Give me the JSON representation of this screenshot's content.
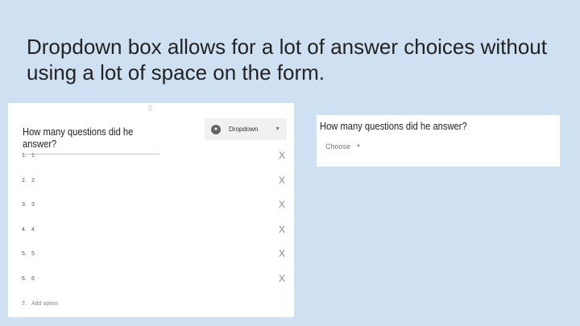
{
  "headline": "Dropdown box allows for a lot of answer choices without using a lot of space on the form.",
  "editor": {
    "drag_handle": "⠿",
    "question": "How many questions did he answer?",
    "type_select": {
      "icon": "dropdown-circle-icon",
      "label": "Dropdown",
      "caret": "▼"
    },
    "options": [
      {
        "num": "1.",
        "label": "1",
        "remove": "X"
      },
      {
        "num": "2.",
        "label": "2",
        "remove": "X"
      },
      {
        "num": "3.",
        "label": "3",
        "remove": "X"
      },
      {
        "num": "4.",
        "label": "4",
        "remove": "X"
      },
      {
        "num": "5.",
        "label": "5",
        "remove": "X"
      },
      {
        "num": "6.",
        "label": "6",
        "remove": "X"
      }
    ],
    "add_option": {
      "num": "7.",
      "label": "Add option"
    }
  },
  "preview": {
    "question": "How many questions did he answer?",
    "select_placeholder": "Choose",
    "caret": "▼"
  }
}
